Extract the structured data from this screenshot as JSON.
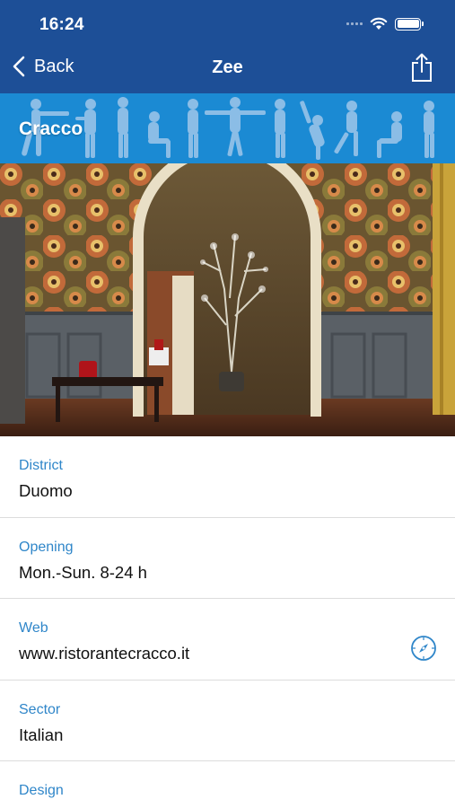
{
  "status_bar": {
    "time": "16:24"
  },
  "nav": {
    "back_label": "Back",
    "title": "Zee"
  },
  "banner": {
    "title": "Cracco"
  },
  "details": [
    {
      "label": "District",
      "value": "Duomo"
    },
    {
      "label": "Opening",
      "value": "Mon.-Sun. 8-24 h"
    },
    {
      "label": "Web",
      "value": "www.ristorantecracco.it"
    },
    {
      "label": "Sector",
      "value": "Italian"
    },
    {
      "label": "Design",
      "value": ""
    }
  ],
  "colors": {
    "nav_bg": "#1d4f97",
    "banner_bg": "#1b8ad3",
    "label": "#2f86c9"
  }
}
